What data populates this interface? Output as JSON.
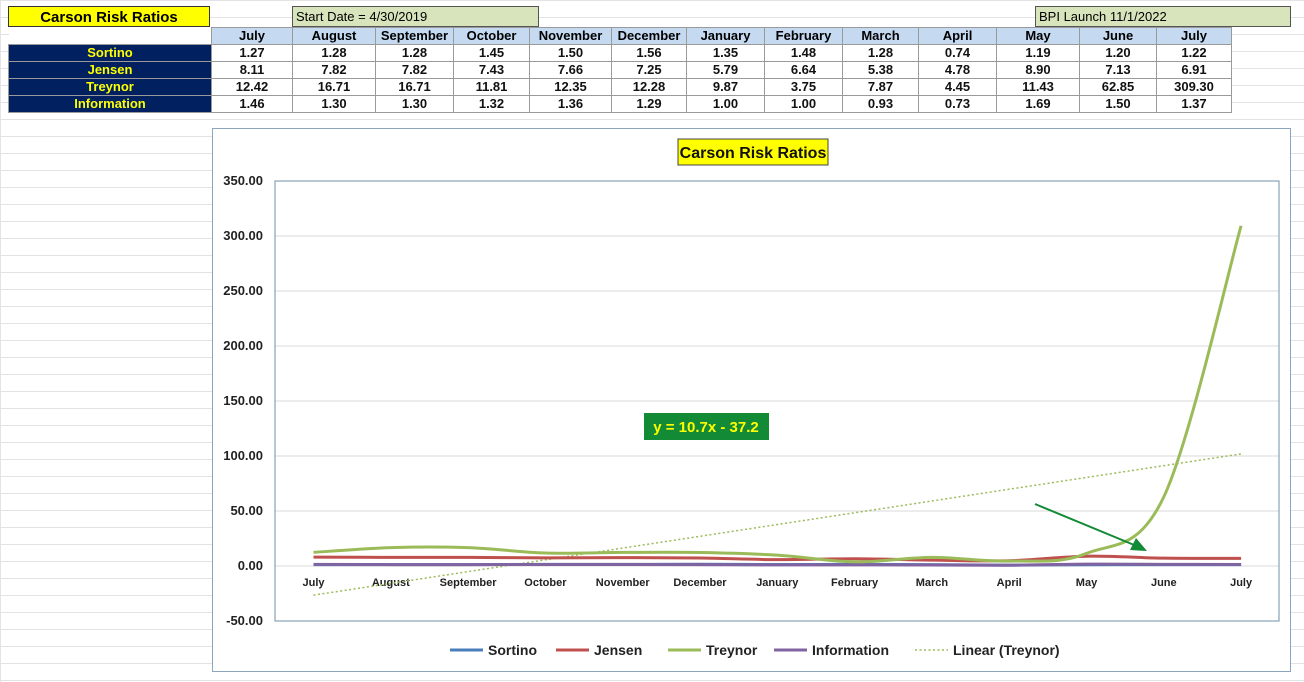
{
  "sheet": {
    "title": "Carson Risk Ratios",
    "start_note": "Start Date = 4/30/2019",
    "launch_note": "BPI Launch 11/1/2022"
  },
  "table": {
    "months": [
      "July",
      "August",
      "September",
      "October",
      "November",
      "December",
      "January",
      "February",
      "March",
      "April",
      "May",
      "June",
      "July"
    ],
    "rows": [
      {
        "label": "Sortino",
        "values": [
          "1.27",
          "1.28",
          "1.28",
          "1.45",
          "1.50",
          "1.56",
          "1.35",
          "1.48",
          "1.28",
          "0.74",
          "1.19",
          "1.20",
          "1.22"
        ]
      },
      {
        "label": "Jensen",
        "values": [
          "8.11",
          "7.82",
          "7.82",
          "7.43",
          "7.66",
          "7.25",
          "5.79",
          "6.64",
          "5.38",
          "4.78",
          "8.90",
          "7.13",
          "6.91"
        ]
      },
      {
        "label": "Treynor",
        "values": [
          "12.42",
          "16.71",
          "16.71",
          "11.81",
          "12.35",
          "12.28",
          "9.87",
          "3.75",
          "7.87",
          "4.45",
          "11.43",
          "62.85",
          "309.30"
        ]
      },
      {
        "label": "Information",
        "values": [
          "1.46",
          "1.30",
          "1.30",
          "1.32",
          "1.36",
          "1.29",
          "1.00",
          "1.00",
          "0.93",
          "0.73",
          "1.69",
          "1.50",
          "1.37"
        ]
      }
    ]
  },
  "chart_data": {
    "type": "line",
    "title": "Carson Risk Ratios",
    "categories": [
      "July",
      "August",
      "September",
      "October",
      "November",
      "December",
      "January",
      "February",
      "March",
      "April",
      "May",
      "June",
      "July"
    ],
    "series": [
      {
        "name": "Sortino",
        "color": "#4a7ebb",
        "values": [
          1.27,
          1.28,
          1.28,
          1.45,
          1.5,
          1.56,
          1.35,
          1.48,
          1.28,
          0.74,
          1.19,
          1.2,
          1.22
        ]
      },
      {
        "name": "Jensen",
        "color": "#c0504d",
        "values": [
          8.11,
          7.82,
          7.82,
          7.43,
          7.66,
          7.25,
          5.79,
          6.64,
          5.38,
          4.78,
          8.9,
          7.13,
          6.91
        ]
      },
      {
        "name": "Treynor",
        "color": "#9bbb59",
        "values": [
          12.42,
          16.71,
          16.71,
          11.81,
          12.35,
          12.28,
          9.87,
          3.75,
          7.87,
          4.45,
          11.43,
          62.85,
          309.3
        ]
      },
      {
        "name": "Information",
        "color": "#8064a2",
        "values": [
          1.46,
          1.3,
          1.3,
          1.32,
          1.36,
          1.29,
          1.0,
          1.0,
          0.93,
          0.73,
          1.69,
          1.5,
          1.37
        ]
      }
    ],
    "trendline": {
      "name": "Linear (Treynor)",
      "color": "#9bbb59",
      "slope": 10.7,
      "intercept": -37.2,
      "equation": "y = 10.7x - 37.2"
    },
    "yticks": [
      "350.00",
      "300.00",
      "250.00",
      "200.00",
      "150.00",
      "100.00",
      "50.00",
      "0.00",
      "-50.00"
    ],
    "ylim": [
      -50,
      350
    ],
    "grid": true,
    "legend": "bottom",
    "annotation": "green arrow pointing to June"
  }
}
